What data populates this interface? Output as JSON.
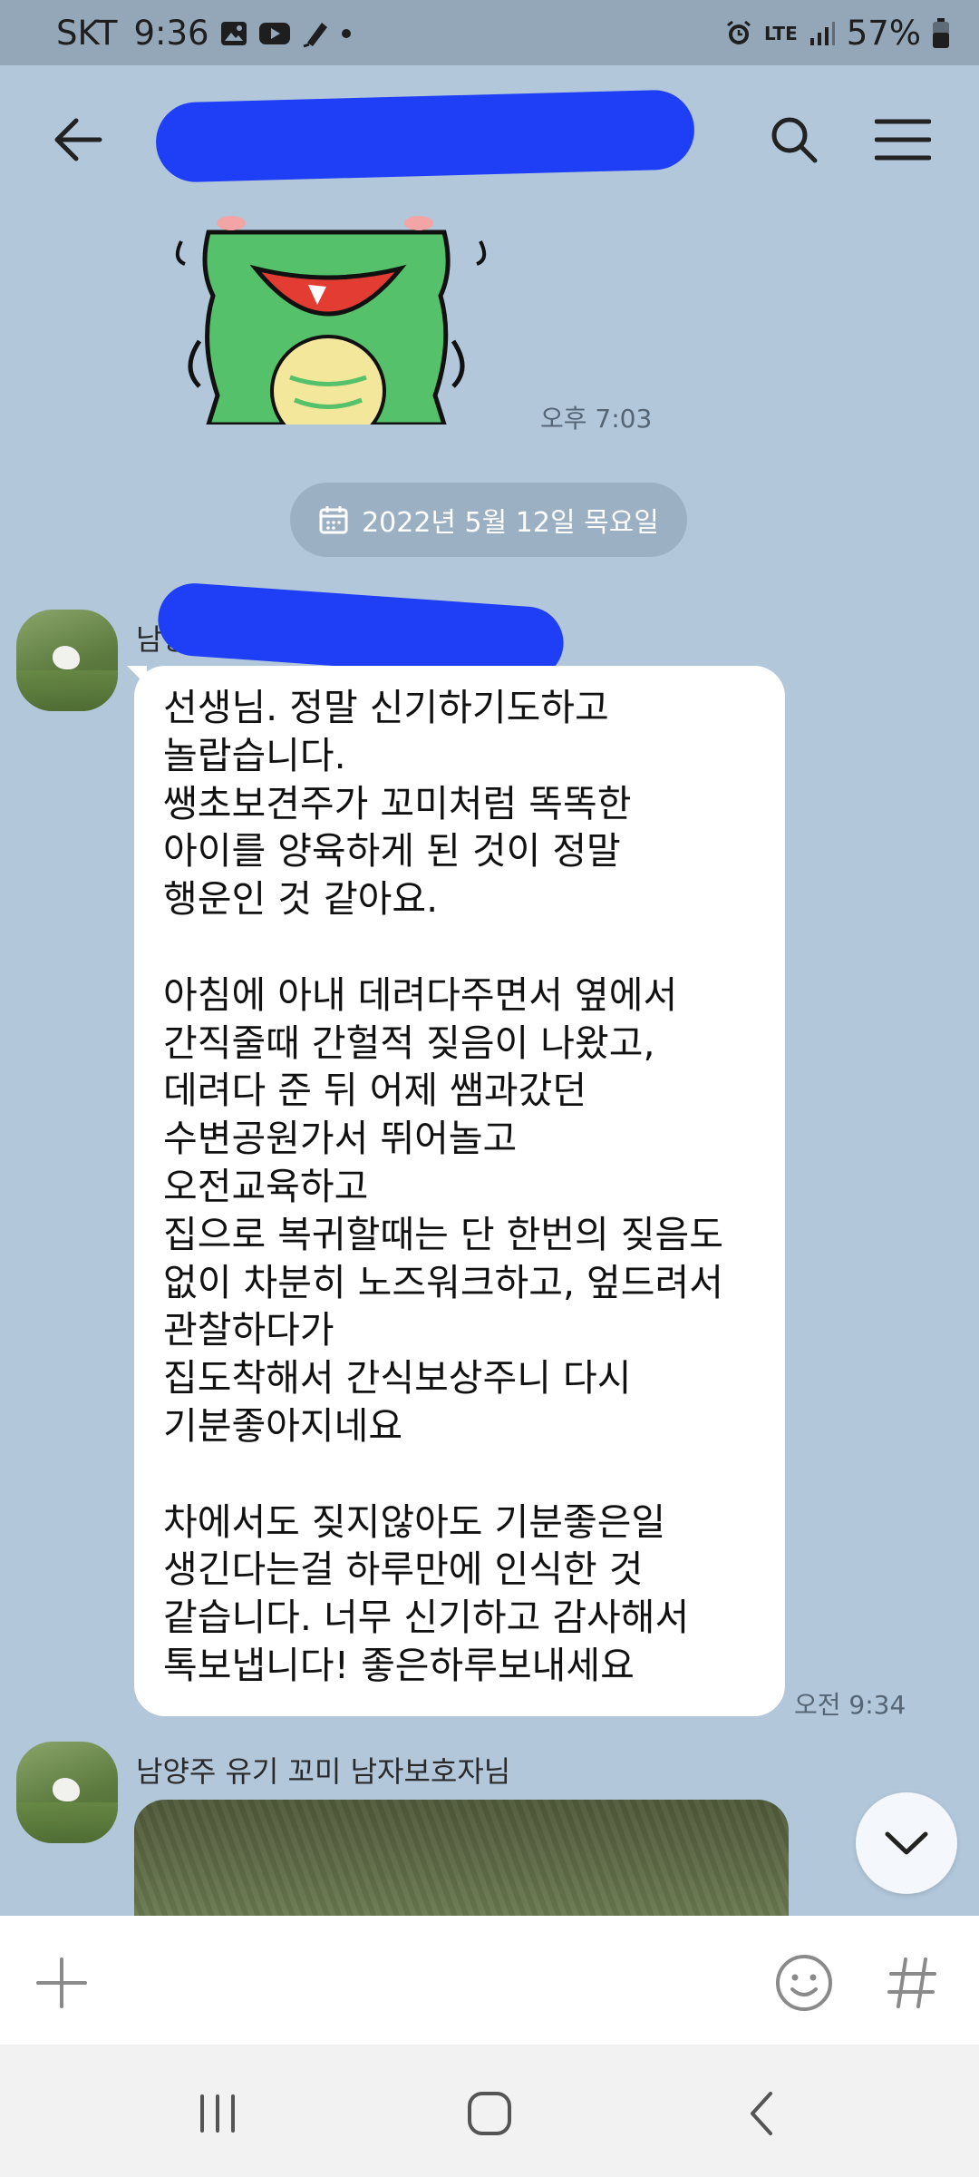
{
  "status_bar": {
    "carrier": "SKT",
    "time": "9:36",
    "network": "LTE",
    "battery": "57%"
  },
  "header": {
    "back_icon": "back-arrow-icon",
    "search_icon": "search-icon",
    "menu_icon": "hamburger-menu-icon"
  },
  "chat": {
    "sticker_time": "오후 7:03",
    "date_divider": "2022년 5월 12일 목요일",
    "messages": [
      {
        "sender_visible": "남양",
        "time": "오전 9:34",
        "lines": [
          "선생님. 정말 신기하기도하고",
          "놀랍습니다.",
          "쌩초보견주가 꼬미처럼 똑똑한",
          "아이를 양육하게 된 것이 정말",
          "행운인 것 같아요.",
          "",
          "아침에 아내 데려다주면서 옆에서",
          "간직줄때 간헐적 짖음이 나왔고,",
          "데려다 준 뒤 어제 쌤과갔던",
          "수변공원가서 뛰어놀고",
          "오전교육하고",
          "집으로 복귀할때는 단 한번의 짖음도",
          "없이 차분히 노즈워크하고, 엎드려서",
          "관찰하다가",
          "집도착해서 간식보상주니 다시",
          "기분좋아지네요",
          "",
          "차에서도 짖지않아도 기분좋은일",
          "생긴다는걸 하루만에 인식한 것",
          "같습니다. 너무 신기하고 감사해서",
          "톡보냅니다! 좋은하루보내세요"
        ]
      },
      {
        "sender": "남양주 유기 꼬미 남자보호자님"
      }
    ]
  },
  "input_bar": {
    "add_icon": "plus-icon",
    "emoji_icon": "emoji-icon",
    "hash_icon": "hashtag-icon"
  },
  "nav_bar": {
    "recents_icon": "recents-icon",
    "home_icon": "home-icon",
    "back_icon": "nav-back-icon"
  },
  "colors": {
    "chat_background": "#b2c7da",
    "redaction": "#1f3ff7",
    "bubble": "#ffffff"
  }
}
